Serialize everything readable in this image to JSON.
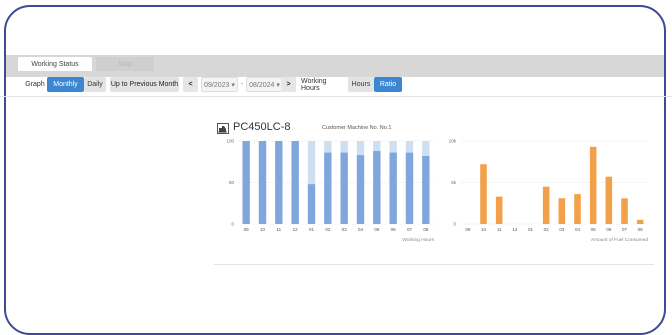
{
  "tabs": [
    {
      "label": "Working Status",
      "active": true
    },
    {
      "label": "Map",
      "active": false
    }
  ],
  "toolbar": {
    "graph_label": "Graph",
    "monthly_label": "Monthly",
    "daily_label": "Daily",
    "prev_month_label": "Up to Previous Month",
    "prev_arrow": "<",
    "next_arrow": ">",
    "from_date": "09/2023 ▾",
    "range_sep": "-",
    "to_date": "08/2024 ▾",
    "working_hours_label": "Working Hours",
    "hours_label": "Hours",
    "ratio_label": "Ratio"
  },
  "machine": {
    "model": "PC450LC-8",
    "customer_label": "Customer Machine No. No.1"
  },
  "colors": {
    "accent": "#3b86d1",
    "ratio_bar": "#7fa7dd",
    "ratio_bar_bg": "#cde0f2",
    "fuel_bar": "#f2a04a",
    "frame": "#3d4a94"
  },
  "chart_data": [
    {
      "type": "bar",
      "name": "working-hours-ratio",
      "categories": [
        "09",
        "10",
        "11",
        "12",
        "01",
        "02",
        "03",
        "04",
        "05",
        "06",
        "07",
        "08"
      ],
      "values": [
        100,
        100,
        100,
        100,
        48,
        86,
        86,
        83,
        88,
        86,
        86,
        82
      ],
      "ylim": [
        0,
        100
      ],
      "yticks": [
        "0",
        "50",
        "100"
      ],
      "xlabel": "Working Hours"
    },
    {
      "type": "bar",
      "name": "fuel-consumed",
      "categories": [
        "09",
        "10",
        "11",
        "12",
        "01",
        "02",
        "03",
        "04",
        "05",
        "06",
        "07",
        "08"
      ],
      "values": [
        0,
        7200,
        3300,
        0,
        0,
        4500,
        3100,
        3600,
        9300,
        5700,
        3100,
        500
      ],
      "ylim": [
        0,
        10000
      ],
      "yticks": [
        "0",
        "5k",
        "10k"
      ],
      "xlabel": "Amount of Fuel Consumed"
    }
  ]
}
